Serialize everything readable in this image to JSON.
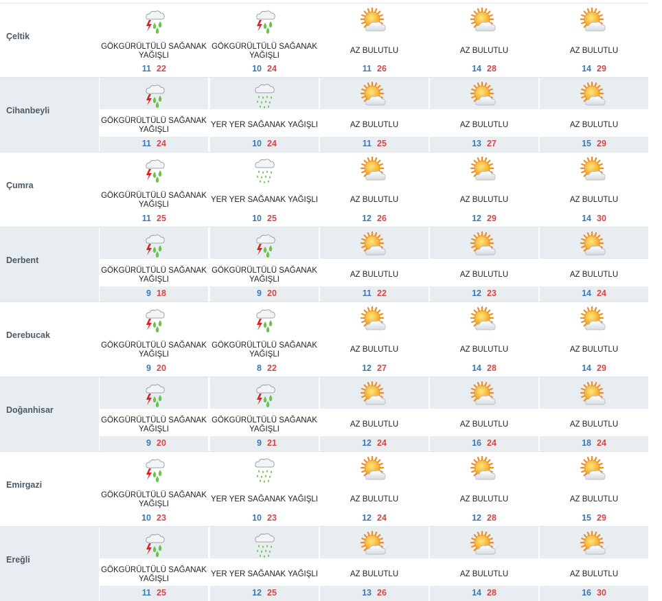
{
  "colors": {
    "row_alt_bg": "#e8edf1",
    "min_temp": "#3a78b8",
    "max_temp": "#d64545",
    "city_text": "#4a5a66"
  },
  "rows": [
    {
      "city": "Çeltik",
      "alt": false,
      "days": [
        {
          "icon": "thunder-rain-icon",
          "desc": "GÖKGÜRÜLTÜLÜ SAĞANAK YAĞIŞLI",
          "min": "11",
          "max": "22"
        },
        {
          "icon": "thunder-rain-icon",
          "desc": "GÖKGÜRÜLTÜLÜ SAĞANAK YAĞIŞLI",
          "min": "10",
          "max": "24"
        },
        {
          "icon": "partly-cloudy-sun-icon",
          "desc": "AZ BULUTLU",
          "min": "11",
          "max": "26"
        },
        {
          "icon": "partly-cloudy-sun-icon",
          "desc": "AZ BULUTLU",
          "min": "14",
          "max": "28"
        },
        {
          "icon": "partly-cloudy-sun-icon",
          "desc": "AZ BULUTLU",
          "min": "14",
          "max": "29"
        }
      ]
    },
    {
      "city": "Cihanbeyli",
      "alt": true,
      "days": [
        {
          "icon": "thunder-rain-icon",
          "desc": "GÖKGÜRÜLTÜLÜ SAĞANAK YAĞIŞLI",
          "min": "11",
          "max": "24"
        },
        {
          "icon": "rain-shower-icon",
          "desc": "YER YER SAĞANAK YAĞIŞLI",
          "min": "10",
          "max": "24"
        },
        {
          "icon": "partly-cloudy-sun-icon",
          "desc": "AZ BULUTLU",
          "min": "11",
          "max": "25"
        },
        {
          "icon": "partly-cloudy-sun-icon",
          "desc": "AZ BULUTLU",
          "min": "13",
          "max": "27"
        },
        {
          "icon": "partly-cloudy-sun-icon",
          "desc": "AZ BULUTLU",
          "min": "15",
          "max": "29"
        }
      ]
    },
    {
      "city": "Çumra",
      "alt": false,
      "days": [
        {
          "icon": "thunder-rain-icon",
          "desc": "GÖKGÜRÜLTÜLÜ SAĞANAK YAĞIŞLI",
          "min": "11",
          "max": "25"
        },
        {
          "icon": "rain-shower-icon",
          "desc": "YER YER SAĞANAK YAĞIŞLI",
          "min": "10",
          "max": "25"
        },
        {
          "icon": "partly-cloudy-sun-icon",
          "desc": "AZ BULUTLU",
          "min": "12",
          "max": "26"
        },
        {
          "icon": "partly-cloudy-sun-icon",
          "desc": "AZ BULUTLU",
          "min": "12",
          "max": "29"
        },
        {
          "icon": "partly-cloudy-sun-icon",
          "desc": "AZ BULUTLU",
          "min": "14",
          "max": "30"
        }
      ]
    },
    {
      "city": "Derbent",
      "alt": true,
      "days": [
        {
          "icon": "thunder-rain-icon",
          "desc": "GÖKGÜRÜLTÜLÜ SAĞANAK YAĞIŞLI",
          "min": "9",
          "max": "18"
        },
        {
          "icon": "thunder-rain-icon",
          "desc": "GÖKGÜRÜLTÜLÜ SAĞANAK YAĞIŞLI",
          "min": "9",
          "max": "20"
        },
        {
          "icon": "partly-cloudy-sun-icon",
          "desc": "AZ BULUTLU",
          "min": "11",
          "max": "22"
        },
        {
          "icon": "partly-cloudy-sun-icon",
          "desc": "AZ BULUTLU",
          "min": "12",
          "max": "23"
        },
        {
          "icon": "partly-cloudy-sun-icon",
          "desc": "AZ BULUTLU",
          "min": "14",
          "max": "24"
        }
      ]
    },
    {
      "city": "Derebucak",
      "alt": false,
      "days": [
        {
          "icon": "thunder-rain-icon",
          "desc": "GÖKGÜRÜLTÜLÜ SAĞANAK YAĞIŞLI",
          "min": "9",
          "max": "20"
        },
        {
          "icon": "thunder-rain-icon",
          "desc": "GÖKGÜRÜLTÜLÜ SAĞANAK YAĞIŞLI",
          "min": "8",
          "max": "22"
        },
        {
          "icon": "partly-cloudy-sun-icon",
          "desc": "AZ BULUTLU",
          "min": "12",
          "max": "27"
        },
        {
          "icon": "partly-cloudy-sun-icon",
          "desc": "AZ BULUTLU",
          "min": "14",
          "max": "28"
        },
        {
          "icon": "partly-cloudy-sun-icon",
          "desc": "AZ BULUTLU",
          "min": "14",
          "max": "29"
        }
      ]
    },
    {
      "city": "Doğanhisar",
      "alt": true,
      "days": [
        {
          "icon": "thunder-rain-icon",
          "desc": "GÖKGÜRÜLTÜLÜ SAĞANAK YAĞIŞLI",
          "min": "9",
          "max": "20"
        },
        {
          "icon": "thunder-rain-icon",
          "desc": "GÖKGÜRÜLTÜLÜ SAĞANAK YAĞIŞLI",
          "min": "9",
          "max": "21"
        },
        {
          "icon": "partly-cloudy-sun-icon",
          "desc": "AZ BULUTLU",
          "min": "12",
          "max": "24"
        },
        {
          "icon": "partly-cloudy-sun-icon",
          "desc": "AZ BULUTLU",
          "min": "16",
          "max": "24"
        },
        {
          "icon": "partly-cloudy-sun-icon",
          "desc": "AZ BULUTLU",
          "min": "18",
          "max": "24"
        }
      ]
    },
    {
      "city": "Emirgazi",
      "alt": false,
      "days": [
        {
          "icon": "thunder-rain-icon",
          "desc": "GÖKGÜRÜLTÜLÜ SAĞANAK YAĞIŞLI",
          "min": "10",
          "max": "23"
        },
        {
          "icon": "rain-shower-icon",
          "desc": "YER YER SAĞANAK YAĞIŞLI",
          "min": "10",
          "max": "23"
        },
        {
          "icon": "partly-cloudy-sun-icon",
          "desc": "AZ BULUTLU",
          "min": "12",
          "max": "24"
        },
        {
          "icon": "partly-cloudy-sun-icon",
          "desc": "AZ BULUTLU",
          "min": "12",
          "max": "28"
        },
        {
          "icon": "partly-cloudy-sun-icon",
          "desc": "AZ BULUTLU",
          "min": "15",
          "max": "29"
        }
      ]
    },
    {
      "city": "Ereğli",
      "alt": true,
      "days": [
        {
          "icon": "thunder-rain-icon",
          "desc": "GÖKGÜRÜLTÜLÜ SAĞANAK YAĞIŞLI",
          "min": "11",
          "max": "25"
        },
        {
          "icon": "rain-shower-icon",
          "desc": "YER YER SAĞANAK YAĞIŞLI",
          "min": "12",
          "max": "25"
        },
        {
          "icon": "partly-cloudy-sun-icon",
          "desc": "AZ BULUTLU",
          "min": "13",
          "max": "26"
        },
        {
          "icon": "partly-cloudy-sun-icon",
          "desc": "AZ BULUTLU",
          "min": "14",
          "max": "28"
        },
        {
          "icon": "partly-cloudy-sun-icon",
          "desc": "AZ BULUTLU",
          "min": "16",
          "max": "30"
        }
      ]
    }
  ]
}
